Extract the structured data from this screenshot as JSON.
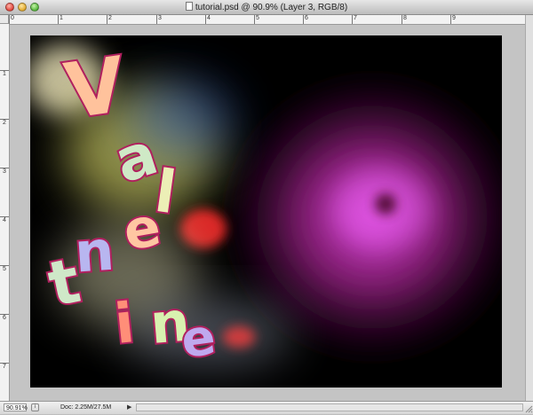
{
  "window": {
    "title": "tutorial.psd @ 90.9% (Layer 3, RGB/8)",
    "traffic_lights": [
      "close",
      "minimize",
      "zoom"
    ]
  },
  "ruler_top": [
    "0",
    "1",
    "2",
    "3",
    "4",
    "5",
    "6",
    "7",
    "8",
    "9"
  ],
  "ruler_left": [
    "1",
    "2",
    "3",
    "4",
    "5",
    "6",
    "7"
  ],
  "canvas": {
    "artwork_letters": [
      "V",
      "a",
      "l",
      "e",
      "n",
      "t",
      "i",
      "n",
      "e"
    ],
    "colors": {
      "background": "#000000",
      "nebula_magenta": "#d23ad8",
      "glow_yellow": "#f3f27a",
      "letter_outline": "#b0205e"
    }
  },
  "status": {
    "zoom": "90.91%",
    "doc": "Doc: 2.25M/27.5M",
    "arrow": "▶"
  }
}
